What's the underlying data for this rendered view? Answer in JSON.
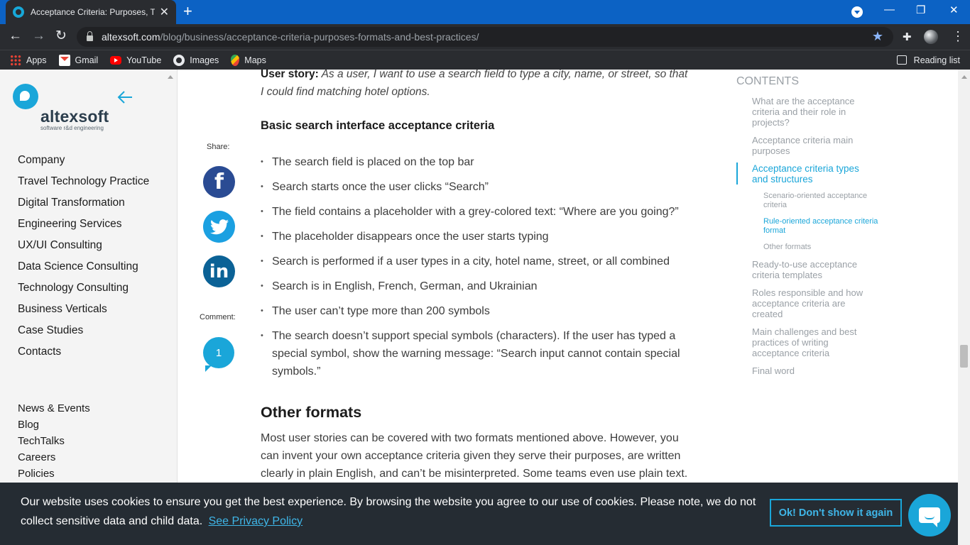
{
  "browser": {
    "tab_title": "Acceptance Criteria: Purposes, Ty",
    "url_host": "altexsoft.com",
    "url_path": "/blog/business/acceptance-criteria-purposes-formats-and-best-practices/",
    "bookmarks": [
      "Apps",
      "Gmail",
      "YouTube",
      "Images",
      "Maps"
    ],
    "reading_list": "Reading list"
  },
  "sidebar": {
    "logo_text": "altexsoft",
    "logo_sub": "software r&d engineering",
    "nav": [
      "Company",
      "Travel Technology Practice",
      "Digital Transformation",
      "Engineering Services",
      "UX/UI Consulting",
      "Data Science Consulting",
      "Technology Consulting",
      "Business Verticals",
      "Case Studies",
      "Contacts"
    ],
    "nav2": [
      "News & Events",
      "Blog",
      "TechTalks",
      "Careers",
      "Policies"
    ]
  },
  "share": {
    "share_label": "Share:",
    "comment_label": "Comment:",
    "comment_count": "1"
  },
  "article": {
    "story_bold": "User story:",
    "story_text": "As a user, I want to use a search field to type a city, name, or street, so that I could find matching hotel options.",
    "heading": "Basic search interface acceptance criteria",
    "bullets": [
      "The search field is placed on the top bar",
      "Search starts once the user clicks “Search”",
      "The field contains a placeholder with a grey-colored text: “Where are you going?”",
      "The placeholder disappears once the user starts typing",
      "Search is performed if a user types in a city, hotel name, street, or all combined",
      "Search is in English, French, German, and Ukrainian",
      "The user can’t type more than 200 symbols",
      "The search doesn’t support special symbols (characters). If the user has typed a special symbol, show the warning message: “Search input cannot contain  special symbols.”"
    ],
    "subheading": "Other formats",
    "paragraph": "Most user stories can be covered with two formats mentioned above. However, you can invent your own acceptance criteria given they serve their purposes, are written clearly in plain English, and can’t be misinterpreted. Some teams even use plain text."
  },
  "toc": {
    "heading": "CONTENTS",
    "items": [
      "What are the acceptance criteria and their role in projects?",
      "Acceptance criteria main purposes",
      "Acceptance criteria types and structures",
      "Scenario-oriented acceptance criteria",
      "Rule-oriented acceptance criteria format",
      "Other formats",
      "Ready-to-use acceptance criteria templates",
      "Roles responsible and how acceptance criteria are created",
      "Main challenges and best practices of writing acceptance criteria",
      "Final word"
    ]
  },
  "cookie": {
    "text": "Our website uses cookies to ensure you get the best experience. By browsing the website you agree to our use of cookies. Please note, we do not collect sensitive data and child data.",
    "link": "See Privacy Policy",
    "button": "Ok! Don't show it again"
  },
  "colors": {
    "brand": "#1aa6d9",
    "chrome_tabbar": "#0c62c4",
    "cookie_bg": "#252c33"
  },
  "icons": [
    "search-field-lock-icon",
    "facebook-icon",
    "twitter-icon",
    "linkedin-icon",
    "comment-icon",
    "chat-icon",
    "back-arrow-icon"
  ]
}
